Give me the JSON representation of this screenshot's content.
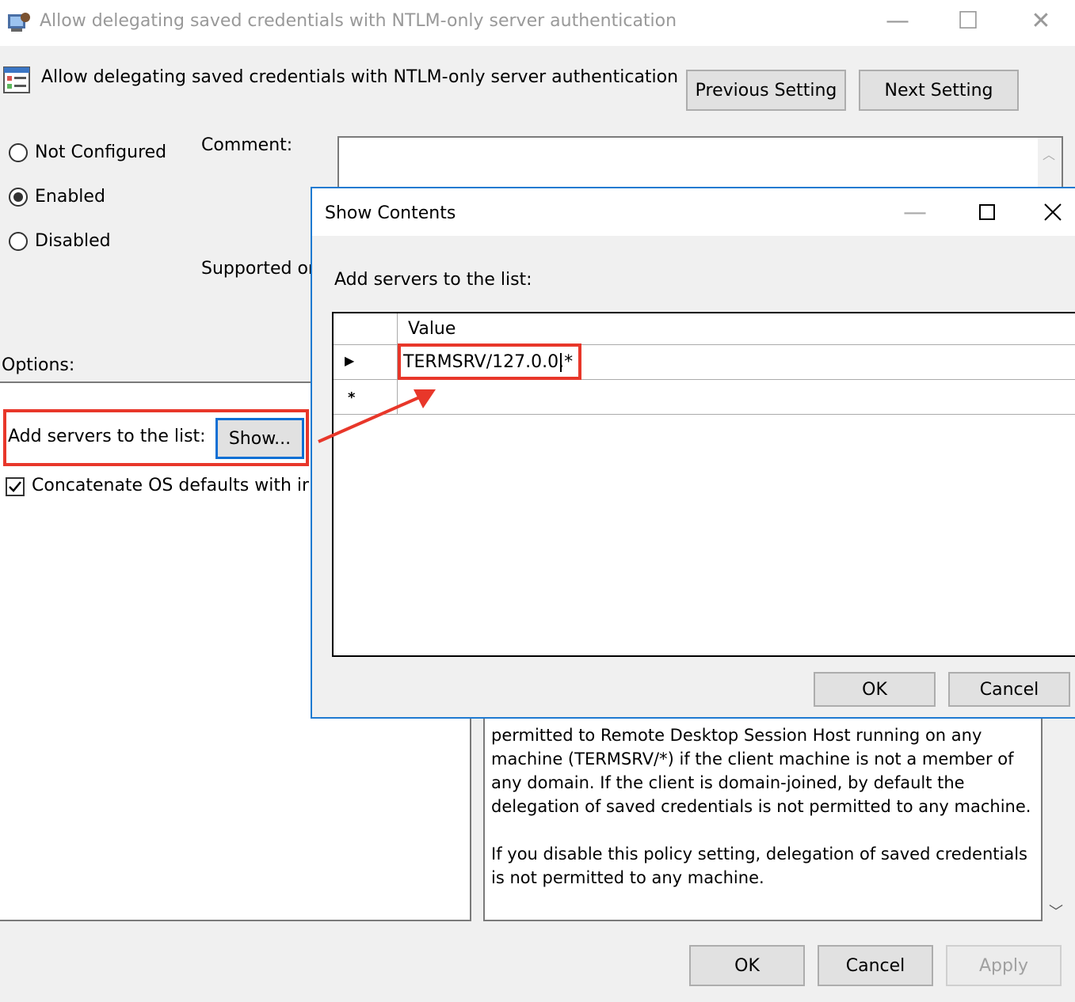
{
  "window": {
    "title": "Allow delegating saved credentials with NTLM-only server authentication",
    "minimize_glyph": "—",
    "maximize_glyph": "☐",
    "close_glyph": "✕"
  },
  "header": {
    "setting_title": "Allow delegating saved credentials with NTLM-only server authentication",
    "previous_label": "Previous Setting",
    "next_label": "Next Setting"
  },
  "state": {
    "options": [
      "Not Configured",
      "Enabled",
      "Disabled"
    ],
    "selected": "Enabled"
  },
  "labels": {
    "comment": "Comment:",
    "supported_on": "Supported on:",
    "options": "Options:"
  },
  "options_panel": {
    "add_servers_label": "Add servers to the list:",
    "show_button": "Show...",
    "concatenate_label": "Concatenate OS defaults with input above",
    "concatenate_checked": true
  },
  "help_text": {
    "paragraph1": "permitted to Remote Desktop Session Host running on any machine (TERMSRV/*) if the client machine is not a member of any domain. If the client is domain-joined, by default the delegation of saved credentials is not permitted to any machine.",
    "paragraph2": "If you disable this policy setting, delegation of saved credentials is not permitted to any machine."
  },
  "footer": {
    "ok": "OK",
    "cancel": "Cancel",
    "apply": "Apply"
  },
  "dialog": {
    "title": "Show Contents",
    "prompt": "Add servers to the list:",
    "column_header": "Value",
    "rows": [
      {
        "indicator": "▶",
        "value": "TERMSRV/127.0.0.*"
      },
      {
        "indicator": "*",
        "value": ""
      }
    ],
    "ok": "OK",
    "cancel": "Cancel"
  },
  "colors": {
    "annotation_red": "#e8372a",
    "focus_blue": "#1e7ad1",
    "window_bg": "#f0f0f0"
  }
}
